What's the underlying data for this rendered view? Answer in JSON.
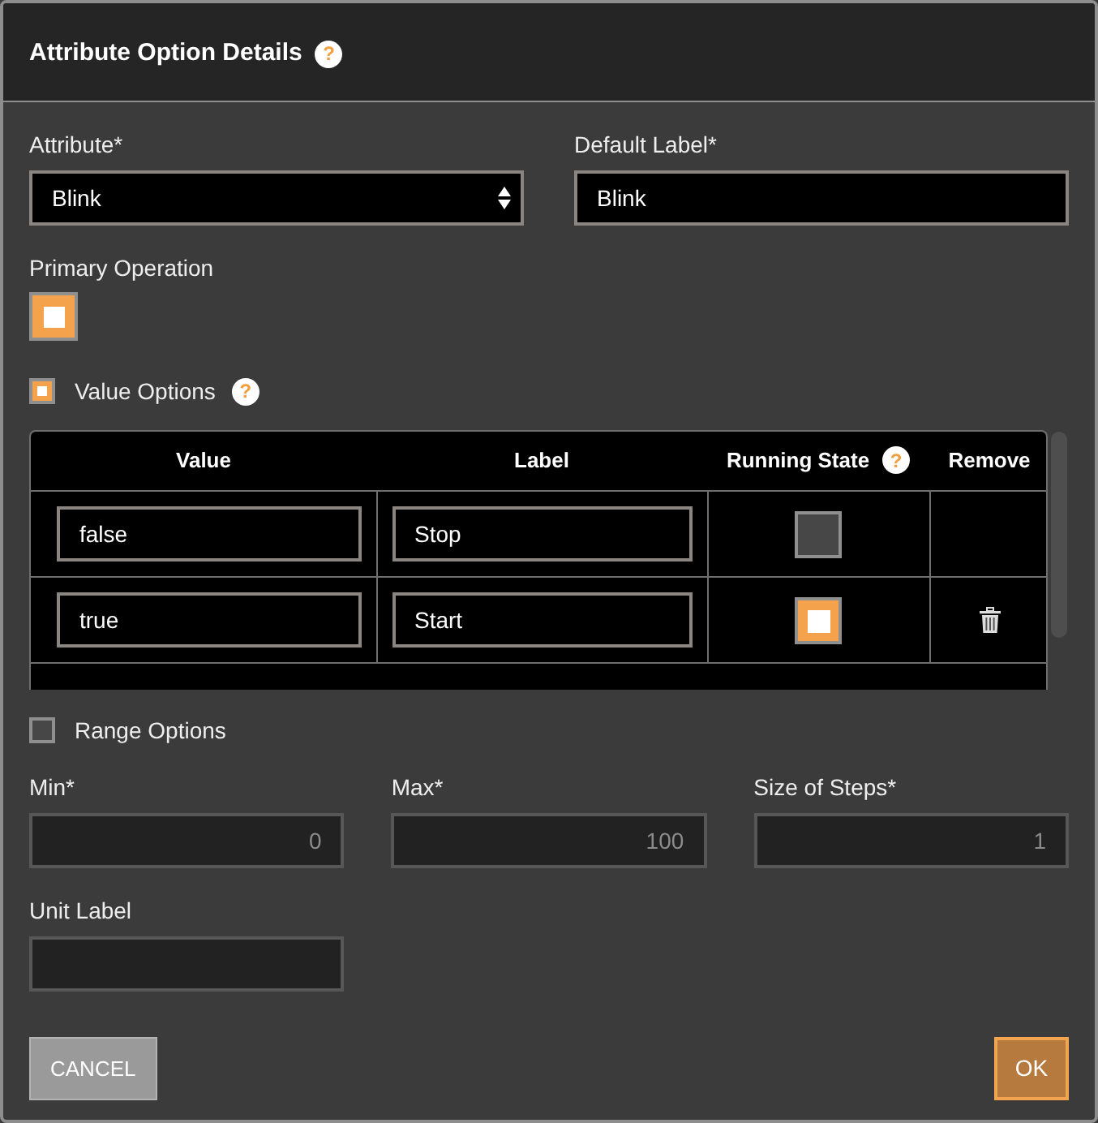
{
  "dialog": {
    "title": "Attribute Option Details",
    "help": "?"
  },
  "attribute": {
    "label": "Attribute*",
    "value": "Blink"
  },
  "default_label": {
    "label": "Default Label*",
    "value": "Blink"
  },
  "primary_operation": {
    "label": "Primary Operation",
    "checked": true
  },
  "value_options": {
    "label": "Value Options",
    "checked": true,
    "help": "?",
    "table": {
      "columns": [
        {
          "label": "Value"
        },
        {
          "label": "Label"
        },
        {
          "label": "Running State",
          "help": "?"
        },
        {
          "label": "Remove"
        }
      ],
      "rows": [
        {
          "value": "false",
          "label": "Stop",
          "running_state": false,
          "removable": false
        },
        {
          "value": "true",
          "label": "Start",
          "running_state": true,
          "removable": true
        }
      ]
    }
  },
  "range_options": {
    "label": "Range Options",
    "checked": false,
    "fields": [
      {
        "label": "Min*",
        "value": "0",
        "disabled": true
      },
      {
        "label": "Max*",
        "value": "100",
        "disabled": true
      },
      {
        "label": "Size of Steps*",
        "value": "1",
        "disabled": true
      }
    ]
  },
  "unit_label": {
    "label": "Unit Label",
    "disabled": true
  },
  "buttons": [
    {
      "label": "CANCEL",
      "kind": "secondary"
    },
    {
      "label": "OK",
      "kind": "primary"
    }
  ]
}
